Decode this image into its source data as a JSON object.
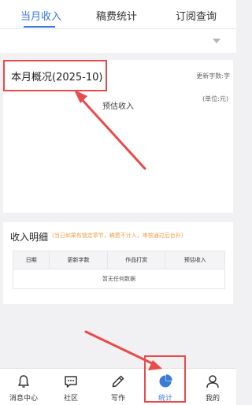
{
  "tabs": [
    {
      "label": "当月收入",
      "active": true
    },
    {
      "label": "稿费统计",
      "active": false
    },
    {
      "label": "订阅查询",
      "active": false
    }
  ],
  "overview": {
    "title": "本月概况(2025-10)",
    "words_label": "更新字数:字",
    "unit": "(单位:元)",
    "estimated_income": "预估收入"
  },
  "detail": {
    "title": "收入明细",
    "note": "(当日如果有锁定章节，稿费不计入，审核通过后台补)",
    "columns": [
      "日期",
      "更新字数",
      "作品打赏",
      "预估收入"
    ],
    "empty_text": "暂无任何数据"
  },
  "bottom_nav": [
    {
      "label": "消息中心",
      "icon": "bell-icon",
      "active": false
    },
    {
      "label": "社区",
      "icon": "chat-icon",
      "active": false
    },
    {
      "label": "写作",
      "icon": "pen-icon",
      "active": false
    },
    {
      "label": "统计",
      "icon": "pie-chart-icon",
      "active": true
    },
    {
      "label": "我的",
      "icon": "user-icon",
      "active": false
    }
  ],
  "colors": {
    "accent": "#3a7bd5",
    "annotation": "#e94a4a",
    "note": "#f0a04b"
  }
}
